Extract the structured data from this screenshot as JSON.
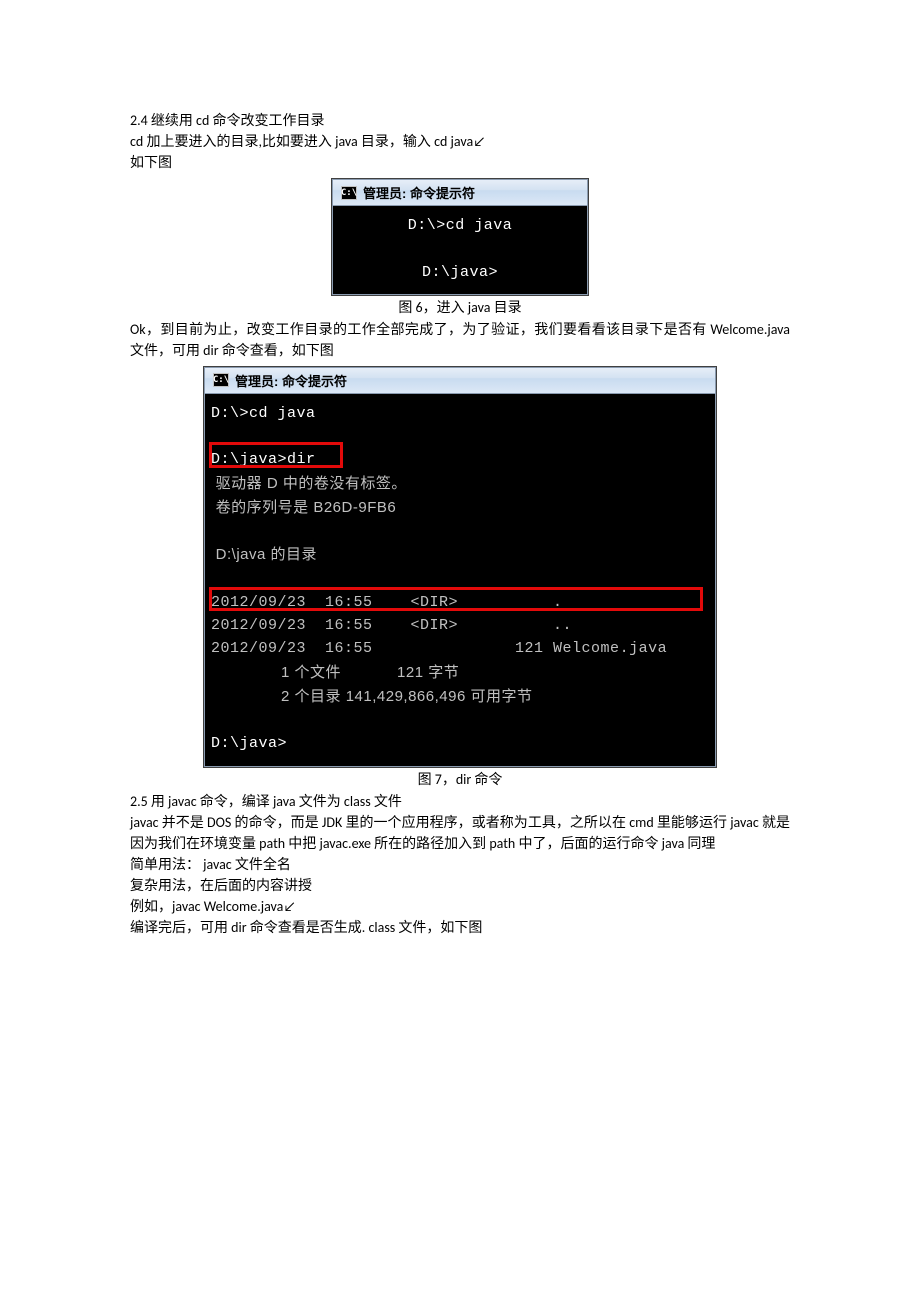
{
  "section24": {
    "heading": "2.4  继续用 cd 命令改变工作目录",
    "p1": "cd  加上要进入的目录,比如要进入 java 目录，输入 cd    java↙",
    "p2": "如下图"
  },
  "fig6": {
    "title_icon": "C:\\",
    "title_text": "管理员: 命令提示符",
    "line1": "D:\\>cd java",
    "line2": "D:\\java>",
    "caption": "图 6，进入 java 目录"
  },
  "midpara": {
    "p1": "Ok，到目前为止，改变工作目录的工作全部完成了，为了验证，我们要看看该目录下是否有 Welcome.java 文件，可用 dir 命令查看，如下图"
  },
  "fig7": {
    "title_icon": "C:\\",
    "title_text": "管理员: 命令提示符",
    "l1": "D:\\>cd java",
    "l2": "D:\\java>dir",
    "l3": " 驱动器 D 中的卷没有标签。",
    "l4": " 卷的序列号是 B26D-9FB6",
    "l5": " D:\\java 的目录",
    "l6": "2012/09/23  16:55    <DIR>          .",
    "l7": "2012/09/23  16:55    <DIR>          ..",
    "l8": "2012/09/23  16:55               121 Welcome.java",
    "l9": "               1 个文件            121 字节",
    "l10": "               2 个目录 141,429,866,496 可用字节",
    "l11": "D:\\java>",
    "caption": "图 7，dir 命令"
  },
  "section25": {
    "heading": "2.5  用 javac 命令，编译 java 文件为 class 文件",
    "p1": "javac  并不是 DOS 的命令，而是 JDK 里的一个应用程序，或者称为工具，之所以在 cmd 里能够运行 javac 就是因为我们在环境变量 path 中把 javac.exe 所在的路径加入到 path 中了，后面的运行命令 java 同理",
    "p2": "简单用法：  javac    文件全名",
    "p3": "复杂用法，在后面的内容讲授",
    "p4": "例如，javac    Welcome.java↙",
    "p5": "编译完后，可用 dir 命令查看是否生成. class 文件，如下图"
  }
}
